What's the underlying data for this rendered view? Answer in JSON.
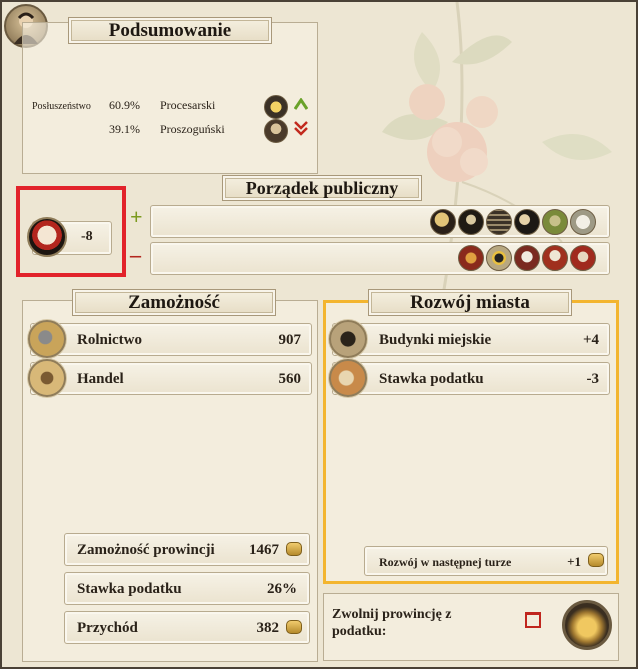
{
  "summary": {
    "title": "Podsumowanie",
    "obedience_label": "Posłuszeństwo",
    "factions": [
      {
        "percent": "60.9%",
        "name": "Procesarski",
        "trend": "up"
      },
      {
        "percent": "39.1%",
        "name": "Proszoguński",
        "trend": "down"
      }
    ]
  },
  "public_order": {
    "title": "Porządek publiczny",
    "value": "-8",
    "plus_sign": "+",
    "minus_sign": "–",
    "plus_icons": [
      "scholar-icon",
      "army-icon",
      "building-icon",
      "clan-icon",
      "faction-icon",
      "food-icon"
    ],
    "minus_icons": [
      "taxes-icon",
      "disorder-icon",
      "religion-icon",
      "samurai-icon",
      "skull-icon"
    ]
  },
  "wealth": {
    "title": "Zamożność",
    "items": [
      {
        "label": "Rolnictwo",
        "value": "907",
        "icon": "farming-icon"
      },
      {
        "label": "Handel",
        "value": "560",
        "icon": "trade-icon"
      }
    ],
    "totals": [
      {
        "label": "Zamożność prowincji",
        "value": "1467",
        "coin": true
      },
      {
        "label": "Stawka podatku",
        "value": "26%",
        "coin": false
      },
      {
        "label": "Przychód",
        "value": "382",
        "coin": true
      }
    ]
  },
  "development": {
    "title": "Rozwój miasta",
    "items": [
      {
        "label": "Budynki miejskie",
        "value": "+4",
        "icon": "town-buildings-icon"
      },
      {
        "label": "Stawka podatku",
        "value": "-3",
        "icon": "tax-rate-icon"
      }
    ],
    "next_turn_label": "Rozwój w następnej turze",
    "next_turn_value": "+1"
  },
  "tax_exempt": {
    "label": "Zwolnij prowincję z podatku:",
    "checked": false
  },
  "colors": {
    "highlight_red": "#e2232b",
    "highlight_gold": "#f3b52f",
    "up_arrow": "#6aa22a",
    "down_arrow": "#c22a1e"
  }
}
